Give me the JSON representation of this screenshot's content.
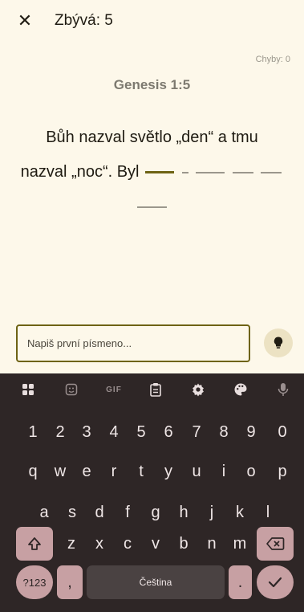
{
  "header": {
    "remaining_label": "Zbývá: 5",
    "errors_label": "Chyby: 0"
  },
  "verse": {
    "reference": "Genesis 1:5",
    "line1": "Bůh nazval světlo „den“ a tmu",
    "line2": "nazval „noc“. Byl"
  },
  "input": {
    "placeholder": "Napiš první písmeno..."
  },
  "keyboard": {
    "toolbar_icons": [
      "apps-icon",
      "sticker-icon",
      "gif-icon",
      "clipboard-icon",
      "settings-icon",
      "palette-icon",
      "mic-icon"
    ],
    "gif_label": "GIF",
    "row_numbers": [
      "1",
      "2",
      "3",
      "4",
      "5",
      "6",
      "7",
      "8",
      "9",
      "0"
    ],
    "row1": [
      "q",
      "w",
      "e",
      "r",
      "t",
      "y",
      "u",
      "i",
      "o",
      "p"
    ],
    "row2": [
      "a",
      "s",
      "d",
      "f",
      "g",
      "h",
      "j",
      "k",
      "l"
    ],
    "row3": [
      "z",
      "x",
      "c",
      "v",
      "b",
      "n",
      "m"
    ],
    "symbols_label": "?123",
    "comma_label": ",",
    "space_label": "Čeština",
    "period_label": "."
  },
  "colors": {
    "background": "#fdf8ea",
    "accent": "#6e6314",
    "keyboard_bg": "#2e2626",
    "key_bg": "#4a4242",
    "special_key_bg": "#c7a0a3"
  }
}
